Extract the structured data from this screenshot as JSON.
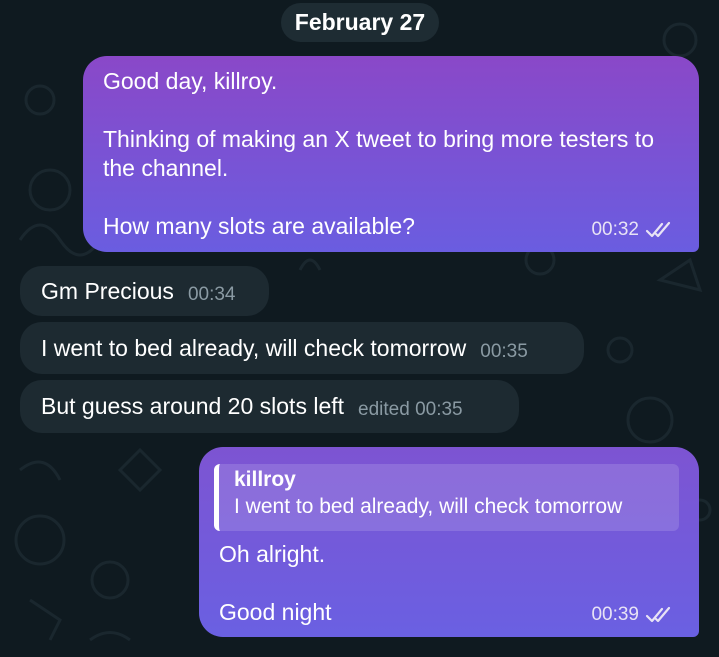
{
  "date_label": "February 27",
  "colors": {
    "background": "#0f1a20",
    "incoming_bubble": "#1d2a31",
    "outgoing_gradient_top": "#8a48c8",
    "outgoing_gradient_bottom": "#6a5de0"
  },
  "messages": [
    {
      "direction": "outgoing",
      "text": "Good day, killroy.\n\nThinking of making an X tweet to bring more testers to the channel.\n\nHow many slots are available?",
      "time": "00:32",
      "status_icon": "double-check-icon"
    },
    {
      "direction": "incoming",
      "text": "Gm Precious",
      "time": "00:34"
    },
    {
      "direction": "incoming",
      "text": "I went to bed already, will check tomorrow",
      "time": "00:35"
    },
    {
      "direction": "incoming",
      "text": "But guess around 20 slots left",
      "time": "edited 00:35"
    },
    {
      "direction": "outgoing",
      "reply_to": {
        "author": "killroy",
        "text": "I went to bed already, will check tomorrow"
      },
      "text": "Oh alright.\n\nGood night",
      "time": "00:39",
      "status_icon": "double-check-icon"
    }
  ]
}
